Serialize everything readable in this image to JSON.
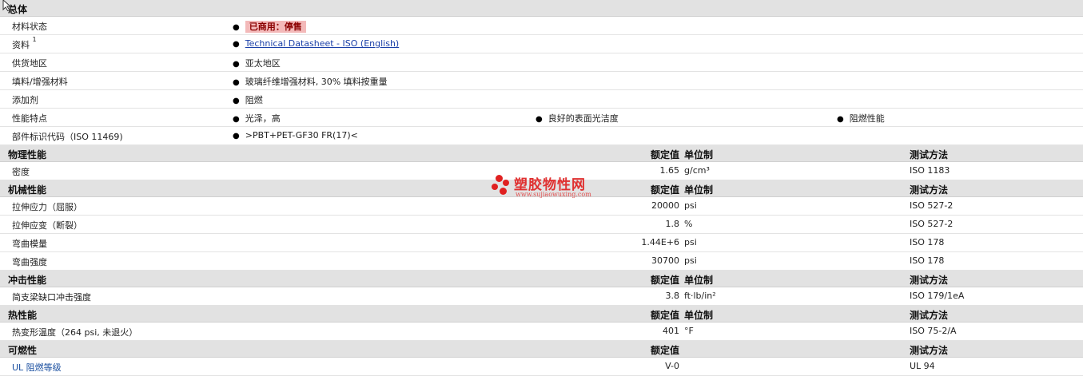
{
  "general": {
    "section_title": "总体",
    "rows": [
      {
        "label": "材料状态",
        "value": "已商用：停售"
      },
      {
        "label": "资料",
        "label_sup": "1",
        "value": "Technical Datasheet - ISO (English)"
      },
      {
        "label": "供货地区",
        "value": "亚太地区"
      },
      {
        "label": "填料/增强材料",
        "value": "玻璃纤维增强材料, 30% 填料按重量"
      },
      {
        "label": "添加剂",
        "value": "阻燃"
      },
      {
        "label": "性能特点",
        "value": "光泽，高",
        "value2": "良好的表面光洁度",
        "value3": "阻燃性能"
      },
      {
        "label": "部件标识代码（ISO 11469)",
        "value": ">PBT+PET-GF30 FR(17)<"
      }
    ]
  },
  "headers": {
    "nominal": "额定值",
    "unit": "单位制",
    "test": "测试方法"
  },
  "physical": {
    "section_title": "物理性能",
    "rows": [
      {
        "label": "密度",
        "value": "1.65",
        "unit": "g/cm³",
        "test": "ISO 1183"
      }
    ]
  },
  "mechanical": {
    "section_title": "机械性能",
    "rows": [
      {
        "label": "拉伸应力（屈服）",
        "value": "20000",
        "unit": "psi",
        "test": "ISO 527-2"
      },
      {
        "label": "拉伸应变（断裂）",
        "value": "1.8",
        "unit": "%",
        "test": "ISO 527-2"
      },
      {
        "label": "弯曲模量",
        "value": "1.44E+6",
        "unit": "psi",
        "test": "ISO 178"
      },
      {
        "label": "弯曲强度",
        "value": "30700",
        "unit": "psi",
        "test": "ISO 178"
      }
    ]
  },
  "impact": {
    "section_title": "冲击性能",
    "rows": [
      {
        "label": "简支梁缺口冲击强度",
        "value": "3.8",
        "unit": "ft·lb/in²",
        "test": "ISO 179/1eA"
      }
    ]
  },
  "thermal": {
    "section_title": "热性能",
    "rows": [
      {
        "label": "热变形温度（264 psi, 未退火）",
        "value": "401",
        "unit": "°F",
        "test": "ISO 75-2/A"
      }
    ]
  },
  "flammability": {
    "section_title": "可燃性",
    "rows": [
      {
        "label": "UL 阻燃等级",
        "value": "V-0",
        "unit": "",
        "test": "UL 94"
      }
    ]
  },
  "watermark": {
    "name": "塑胶物性网",
    "url": "www.sujiaowuxing.com"
  },
  "colors": {
    "header_bg": "#e2e2e2",
    "badge_bg": "#f3b9b9",
    "link": "#1a3fa8",
    "watermark": "#e02020"
  }
}
